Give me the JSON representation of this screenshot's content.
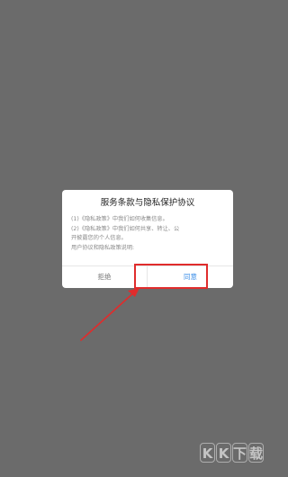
{
  "dialog": {
    "title": "服务条款与隐私保护协议",
    "body_lines": [
      "(1)《隐私政策》中我们如何收集信息。",
      "(2)《隐私政策》中我们如何共享、转让、公",
      "开披露您的个人信息。",
      "用户协议和隐私政策说明:"
    ],
    "reject_label": "拒绝",
    "agree_label": "同意"
  },
  "annotation": {
    "highlight_color": "#e02c2c",
    "arrow_color": "#e02c2c"
  },
  "watermark": {
    "chars": [
      "K",
      "K",
      "下",
      "载"
    ]
  },
  "colors": {
    "backdrop": "#6b6b6b",
    "accent": "#3d8fe8"
  }
}
